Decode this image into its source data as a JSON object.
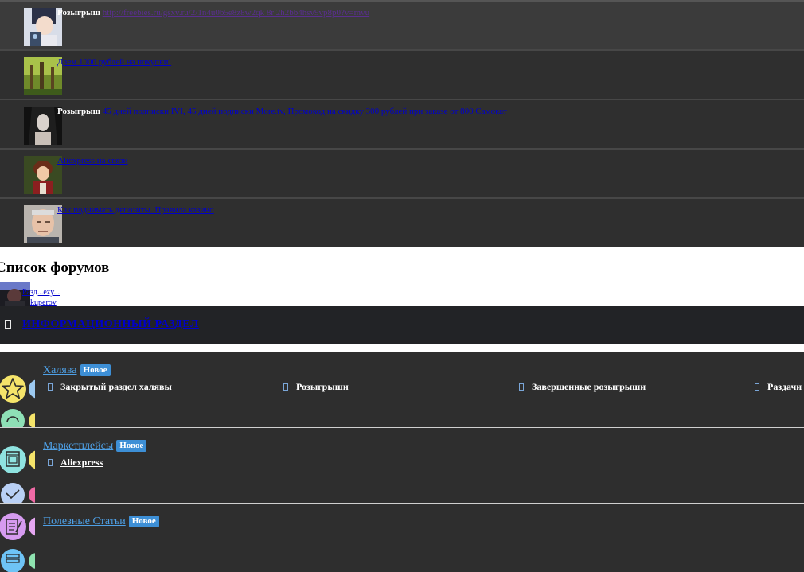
{
  "threads": [
    {
      "prefix": "Розыгрыш",
      "title": "http://freebies.ru/gsxv.ru/2/1n4u0b5e8z8w2qk 8r 2h2bb4hsv9vp8p0?v=mvu",
      "visited": true
    },
    {
      "prefix": "",
      "title": "Даем 1000 рублей на покупки!",
      "visited": false
    },
    {
      "prefix": "Розыгрыш",
      "title": "45 дней подписки IVI, 45 дней подписки More.tv, Промокод на скидку 300 рублей при заказе от 800 Самокат",
      "visited": false
    },
    {
      "prefix": "",
      "title": "Aliexpress на связи",
      "visited": false
    },
    {
      "prefix": "",
      "title": "Как поднимать депозиты. Правила казино",
      "visited": false
    }
  ],
  "forum_list_title": "Список форумов",
  "user_widget": {
    "line1": "Разд...ezy...",
    "line2": "kuperov"
  },
  "category": {
    "title": "ИНФОРМАЦИОННЫЙ РАЗДЕЛ"
  },
  "forums": [
    {
      "name": "Халява",
      "badge": "Новое",
      "subforums": [
        "Закрытый раздел халявы",
        "Розыгрыши",
        "Завершенные розыгрыши",
        "Раздачи"
      ]
    },
    {
      "name": "Маркетплейсы",
      "badge": "Новое",
      "subforums": [
        "Aliexpress"
      ]
    },
    {
      "name": "Полезные Статьи",
      "badge": "Новое",
      "subforums": []
    }
  ],
  "icons": {
    "toggle": "collapse-square-icon",
    "forum_1": [
      "star-icon",
      "globe-icon"
    ],
    "forum_2": [
      "store-icon",
      "cart-icon"
    ],
    "forum_3": [
      "notepad-icon",
      "document-stack-icon"
    ]
  },
  "colors": {
    "thread_bg": "#2f2f2f",
    "category_bar": "#222326",
    "forum_link": "#4ea0e6",
    "badge": "#3d8fd6"
  }
}
